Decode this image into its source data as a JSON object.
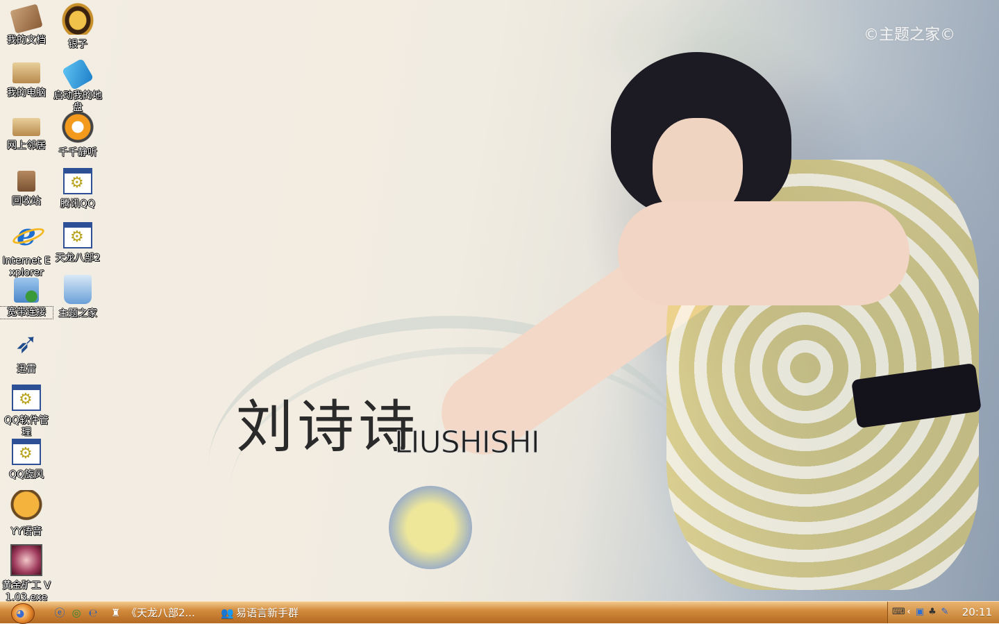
{
  "wallpaper": {
    "title_cn": "刘诗诗",
    "title_en": "LIUSHISHI",
    "watermark": "©主题之家©"
  },
  "desktop": {
    "icons": [
      {
        "label": "我的文档",
        "icon": "documents-icon"
      },
      {
        "label": "我的电脑",
        "icon": "computer-icon"
      },
      {
        "label": "网上邻居",
        "icon": "network-icon"
      },
      {
        "label": "回收站",
        "icon": "recycle-bin-icon"
      },
      {
        "label": "Internet Explorer",
        "icon": "ie-icon"
      },
      {
        "label": "宽带连接",
        "icon": "broadband-icon"
      },
      {
        "label": "迅雷",
        "icon": "xunlei-icon"
      },
      {
        "label": "QQ软件管理",
        "icon": "app-icon"
      },
      {
        "label": "QQ旋风",
        "icon": "app-icon"
      },
      {
        "label": "YY语音",
        "icon": "yy-icon"
      },
      {
        "label": "黄金矿工 V1.03.exe",
        "icon": "gold-miner-icon"
      },
      {
        "label": "银子",
        "icon": "yinzi-icon"
      },
      {
        "label": "启动我的地盘",
        "icon": "lock-icon"
      },
      {
        "label": "千千静听",
        "icon": "ttplayer-icon"
      },
      {
        "label": "腾讯QQ",
        "icon": "app-icon"
      },
      {
        "label": "天龙八部2",
        "icon": "app-icon"
      },
      {
        "label": "主题之家",
        "icon": "theme-icon"
      }
    ]
  },
  "taskbar": {
    "tasks": [
      {
        "label": "《天龙八部2...",
        "icon": "game-icon"
      },
      {
        "label": "易语言新手群",
        "icon": "group-chat-icon"
      }
    ],
    "clock": "20:11"
  }
}
